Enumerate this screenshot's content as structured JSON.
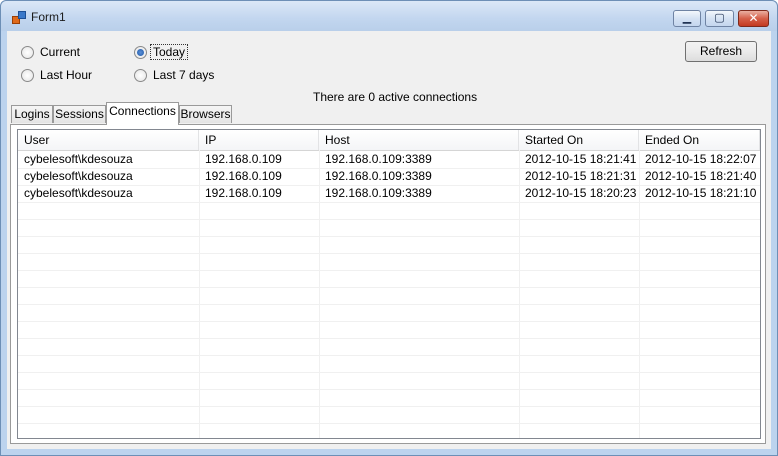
{
  "window": {
    "title": "Form1"
  },
  "filters": {
    "current": "Current",
    "last_hour": "Last Hour",
    "today": "Today",
    "last_7_days": "Last 7 days",
    "selected": "Today"
  },
  "refresh_label": "Refresh",
  "status_text": "There are 0 active connections",
  "tabs": [
    "Logins",
    "Sessions",
    "Connections",
    "Browsers"
  ],
  "active_tab": "Connections",
  "table": {
    "columns": [
      "User",
      "IP",
      "Host",
      "Started On",
      "Ended On"
    ],
    "rows": [
      [
        "cybelesoft\\kdesouza",
        "192.168.0.109",
        "192.168.0.109:3389",
        "2012-10-15 18:21:41",
        "2012-10-15 18:22:07"
      ],
      [
        "cybelesoft\\kdesouza",
        "192.168.0.109",
        "192.168.0.109:3389",
        "2012-10-15 18:21:31",
        "2012-10-15 18:21:40"
      ],
      [
        "cybelesoft\\kdesouza",
        "192.168.0.109",
        "192.168.0.109:3389",
        "2012-10-15 18:20:23",
        "2012-10-15 18:21:10"
      ]
    ]
  }
}
